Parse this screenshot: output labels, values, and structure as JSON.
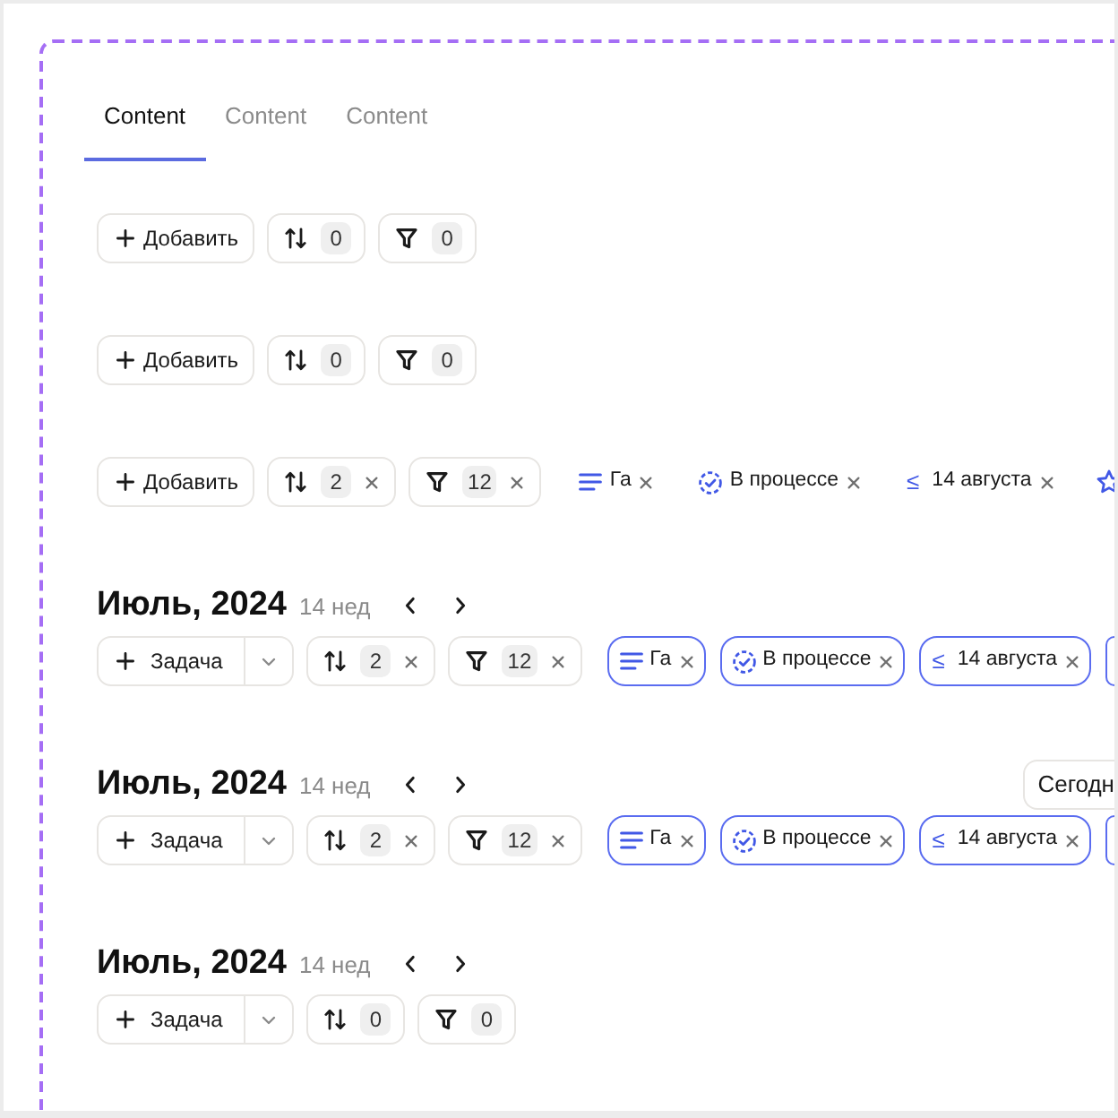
{
  "tabs": [
    {
      "label": "Content",
      "selected": true
    },
    {
      "label": "Content",
      "selected": false
    },
    {
      "label": "Content",
      "selected": false
    }
  ],
  "sections": [
    {
      "toolbar": {
        "add": {
          "kind": "plain",
          "label": "Добавить"
        },
        "sort": {
          "count": "0",
          "clearable": false
        },
        "filter": {
          "count": "0",
          "clearable": false
        }
      }
    },
    {
      "toolbar": {
        "add": {
          "kind": "plain",
          "label": "Добавить"
        },
        "sort": {
          "count": "0",
          "clearable": false
        },
        "filter": {
          "count": "0",
          "clearable": false
        }
      }
    },
    {
      "toolbar": {
        "add": {
          "kind": "plain",
          "label": "Добавить"
        },
        "sort": {
          "count": "2",
          "clearable": true
        },
        "filter": {
          "count": "12",
          "clearable": true
        },
        "chips_outlined": false,
        "chips": [
          {
            "kind": "text",
            "label": "Га"
          },
          {
            "kind": "status",
            "label": "В процессе"
          },
          {
            "kind": "date",
            "sign": "≤",
            "label": "14 августа"
          },
          {
            "kind": "custom"
          }
        ]
      }
    },
    {
      "header": {
        "title": "Июль, 2024",
        "subtitle": "14 нед"
      },
      "toolbar": {
        "add": {
          "kind": "split",
          "label": "Задача"
        },
        "sort": {
          "count": "2",
          "clearable": true
        },
        "filter": {
          "count": "12",
          "clearable": true
        },
        "chips_outlined": true,
        "chips": [
          {
            "kind": "text",
            "label": "Га"
          },
          {
            "kind": "status",
            "label": "В процессе"
          },
          {
            "kind": "date",
            "sign": "≤",
            "label": "14 августа"
          },
          {
            "kind": "edge"
          }
        ]
      }
    },
    {
      "header": {
        "title": "Июль, 2024",
        "subtitle": "14 нед",
        "today_button": "Сегодн"
      },
      "toolbar": {
        "add": {
          "kind": "split",
          "label": "Задача"
        },
        "sort": {
          "count": "2",
          "clearable": true
        },
        "filter": {
          "count": "12",
          "clearable": true
        },
        "chips_outlined": true,
        "chips": [
          {
            "kind": "text",
            "label": "Га"
          },
          {
            "kind": "status",
            "label": "В процессе"
          },
          {
            "kind": "date",
            "sign": "≤",
            "label": "14 августа"
          },
          {
            "kind": "edge"
          }
        ]
      }
    },
    {
      "header": {
        "title": "Июль, 2024",
        "subtitle": "14 нед"
      },
      "toolbar": {
        "add": {
          "kind": "split",
          "label": "Задача"
        },
        "sort": {
          "count": "0",
          "clearable": false
        },
        "filter": {
          "count": "0",
          "clearable": false
        }
      }
    }
  ]
}
